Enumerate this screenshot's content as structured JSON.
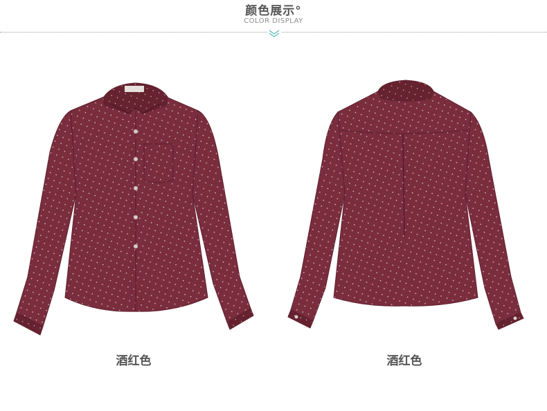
{
  "header": {
    "title_cn": "颜色展示°",
    "title_en": "COLOR DISPLAY"
  },
  "products": [
    {
      "view": "front",
      "color_label": "酒红色"
    },
    {
      "view": "back",
      "color_label": "酒红色"
    }
  ],
  "colors": {
    "shirt": "#7a2d3d",
    "shirt_dark": "#5e1f2d",
    "shirt_light": "#8b3a4b",
    "dot": "#e9d8dc",
    "accent_teal": "#5bb8b8",
    "heading_text": "#555555"
  },
  "icons": {
    "divider_chevron": "double-chevron-down-icon"
  }
}
